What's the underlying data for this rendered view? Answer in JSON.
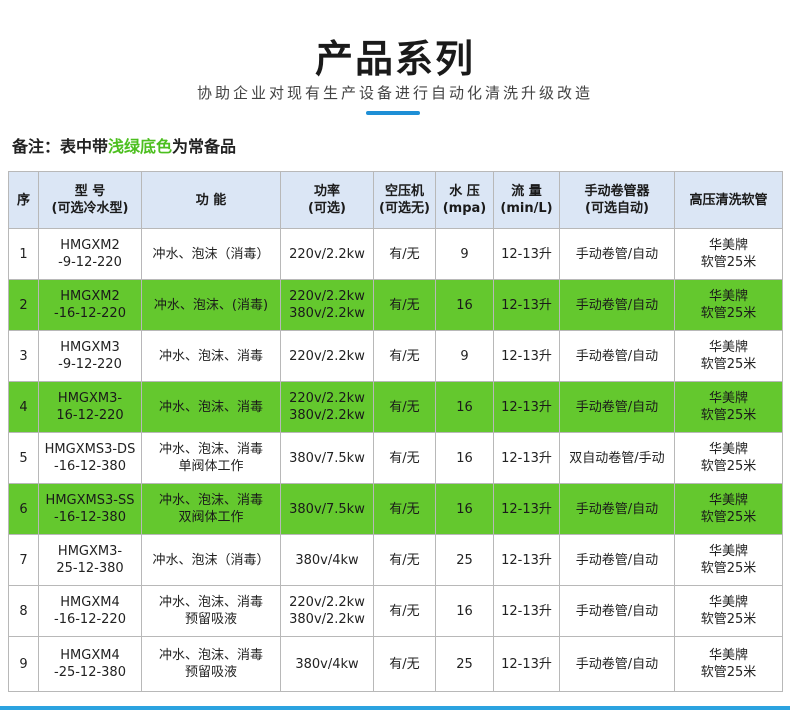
{
  "header": {
    "title": "产品系列",
    "subtitle": "协助企业对现有生产设备进行自动化清洗升级改造",
    "accent_color": "#1e8fd6"
  },
  "note": {
    "prefix": "备注：表中带",
    "highlight": "浅绿底色",
    "suffix": "为常备品",
    "highlight_color": "#4cbf1f"
  },
  "table": {
    "highlight_row_color": "#64c82e",
    "header_color": "#dbe6f5",
    "columns": [
      "序",
      "型  号\n(可选冷水型)",
      "功  能",
      "功率\n(可选)",
      "空压机\n(可选无)",
      "水 压\n(mpa)",
      "流  量\n(min/L)",
      "手动卷管器\n(可选自动)",
      "高压清洗软管"
    ],
    "rows": [
      {
        "green": false,
        "cells": [
          "1",
          "HMGXM2\n-9-12-220",
          "冲水、泡沫（消毒）",
          "220v/2.2kw",
          "有/无",
          "9",
          "12-13升",
          "手动卷管/自动",
          "华美牌\n软管25米"
        ]
      },
      {
        "green": true,
        "cells": [
          "2",
          "HMGXM2\n-16-12-220",
          "冲水、泡沫、(消毒)",
          "220v/2.2kw\n380v/2.2kw",
          "有/无",
          "16",
          "12-13升",
          "手动卷管/自动",
          "华美牌\n软管25米"
        ]
      },
      {
        "green": false,
        "cells": [
          "3",
          "HMGXM3\n-9-12-220",
          "冲水、泡沫、消毒",
          "220v/2.2kw",
          "有/无",
          "9",
          "12-13升",
          "手动卷管/自动",
          "华美牌\n软管25米"
        ]
      },
      {
        "green": true,
        "cells": [
          "4",
          "HMGXM3-\n16-12-220",
          "冲水、泡沫、消毒",
          "220v/2.2kw\n380v/2.2kw",
          "有/无",
          "16",
          "12-13升",
          "手动卷管/自动",
          "华美牌\n软管25米"
        ]
      },
      {
        "green": false,
        "cells": [
          "5",
          "HMGXMS3-DS\n-16-12-380",
          "冲水、泡沫、消毒\n单阀体工作",
          "380v/7.5kw",
          "有/无",
          "16",
          "12-13升",
          "双自动卷管/手动",
          "华美牌\n软管25米"
        ]
      },
      {
        "green": true,
        "cells": [
          "6",
          "HMGXMS3-SS\n-16-12-380",
          "冲水、泡沫、消毒\n双阀体工作",
          "380v/7.5kw",
          "有/无",
          "16",
          "12-13升",
          "手动卷管/自动",
          "华美牌\n软管25米"
        ]
      },
      {
        "green": false,
        "cells": [
          "7",
          "HMGXM3-\n25-12-380",
          "冲水、泡沫（消毒）",
          "380v/4kw",
          "有/无",
          "25",
          "12-13升",
          "手动卷管/自动",
          "华美牌\n软管25米"
        ]
      },
      {
        "green": false,
        "cells": [
          "8",
          "HMGXM4\n-16-12-220",
          "冲水、泡沫、消毒\n预留吸液",
          "220v/2.2kw\n380v/2.2kw",
          "有/无",
          "16",
          "12-13升",
          "手动卷管/自动",
          "华美牌\n软管25米"
        ]
      },
      {
        "green": false,
        "cells": [
          "9",
          "HMGXM4\n-25-12-380",
          "冲水、泡沫、消毒\n预留吸液",
          "380v/4kw",
          "有/无",
          "25",
          "12-13升",
          "手动卷管/自动",
          "华美牌\n软管25米"
        ]
      }
    ]
  }
}
